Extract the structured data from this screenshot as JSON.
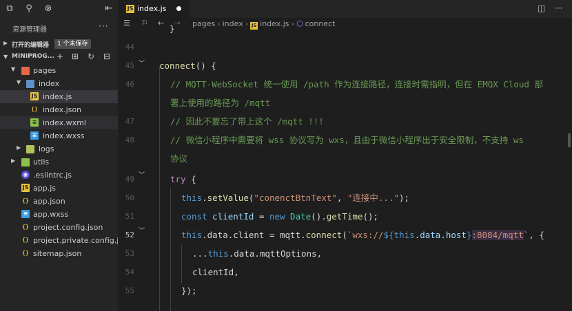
{
  "sidebar": {
    "explorer_title": "资源管理器",
    "more_icon": "ellipsis-icon",
    "open_editors_label": "打开的编辑器",
    "unsaved_badge": "1 个未保存",
    "project_label": "MINIPROG...",
    "tree": [
      {
        "name": "pages",
        "type": "folder",
        "color": "#e8674a"
      },
      {
        "name": "index",
        "type": "folder",
        "color": "#5f8fc7"
      },
      {
        "name": "index.js",
        "type": "js"
      },
      {
        "name": "index.json",
        "type": "json"
      },
      {
        "name": "index.wxml",
        "type": "wxml"
      },
      {
        "name": "index.wxss",
        "type": "wxss"
      },
      {
        "name": "logs",
        "type": "folder",
        "color": "#b4c15a"
      },
      {
        "name": "utils",
        "type": "folder",
        "color": "#8dc149"
      },
      {
        "name": ".eslintrc.js",
        "type": "eslint"
      },
      {
        "name": "app.js",
        "type": "js"
      },
      {
        "name": "app.json",
        "type": "json"
      },
      {
        "name": "app.wxss",
        "type": "wxss"
      },
      {
        "name": "project.config.json",
        "type": "json"
      },
      {
        "name": "project.private.config.js...",
        "type": "json"
      },
      {
        "name": "sitemap.json",
        "type": "json"
      }
    ]
  },
  "tab": {
    "label": "index.js",
    "icon": "JS"
  },
  "breadcrumb": {
    "p1": "pages",
    "p2": "index",
    "p3": "index.js",
    "p4": "connect"
  },
  "code": {
    "line_numbers": [
      "44",
      "45",
      "46",
      "",
      "47",
      "48",
      "",
      "49",
      "50",
      "51",
      "52",
      "53",
      "54",
      "55"
    ],
    "l45": {
      "fn": "connect",
      "rest": "() {"
    },
    "l46a": "// MQTT-WebSocket 统一使用 /path 作为连接路径，连接时需指明，但在 EMQX Cloud 部",
    "l46b": "署上使用的路径为 /mqtt",
    "l47": "// 因此不要忘了带上这个 /mqtt !!!",
    "l48a": "// 微信小程序中需要将 wss 协议写为 wxs，且由于微信小程序出于安全限制，不支持 ws",
    "l48b": "协议",
    "l49": {
      "kw": "try",
      "rest": " {"
    },
    "l50": {
      "kw": "this",
      "dot": ".",
      "fn": "setValue",
      "p1": "(",
      "s1": "\"conenctBtnText\"",
      "comma": ", ",
      "s2": "\"连接中...\"",
      "end": ");"
    },
    "l51": {
      "kw": "const",
      "var": " clientId",
      "eq": " = ",
      "new": "new",
      "cls": " Date",
      "p": "().",
      "fn": "getTime",
      "end": "();"
    },
    "l52": {
      "kw": "this",
      "d1": ".data.client = mqtt.",
      "fn": "connect",
      "p": "(",
      "s1": "`wxs://",
      "t1": "${",
      "kw2": "this",
      "t2": ".data.host",
      "t3": "}",
      "s2": ":8084/mqtt",
      "s3": "`",
      "end": ", {"
    },
    "l53": {
      "spread": "...",
      "kw": "this",
      "rest": ".data.mqttOptions,"
    },
    "l54": "clientId,",
    "l55": "});"
  }
}
